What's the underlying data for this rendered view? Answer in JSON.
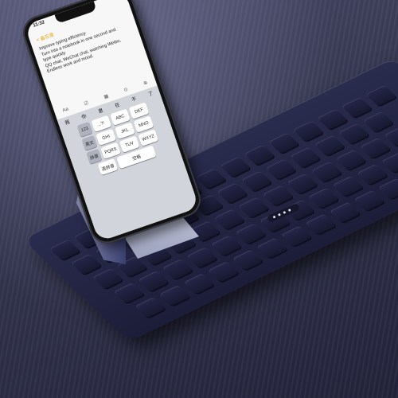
{
  "phone": {
    "status_time": "11:32",
    "back_label": "< 备忘录",
    "note_lines": [
      "Improve typing efficiency",
      "Turn into a notebook in one second and",
      "type quickly",
      "QQ chat, WeChat chat, watching Weibo,",
      "Endless work and mood."
    ],
    "toolbar": [
      "Aa",
      "☑",
      "▦",
      "⊙",
      "⊗"
    ],
    "candidates": [
      "我",
      "你",
      "是",
      "在",
      "不",
      "了"
    ],
    "keypad_rows": [
      [
        ",.?!",
        "ABC",
        "DEF"
      ],
      [
        "GHI",
        "JKL",
        "MNO"
      ],
      [
        "PQRS",
        "TUV",
        "WXYZ"
      ],
      [
        "选拼音",
        "空格"
      ]
    ],
    "side_keys": [
      "123",
      "英文",
      "拼音"
    ]
  },
  "colors": {
    "table": "#34364f",
    "keyboard": "#1f2040",
    "stand": "#8c91b6"
  }
}
